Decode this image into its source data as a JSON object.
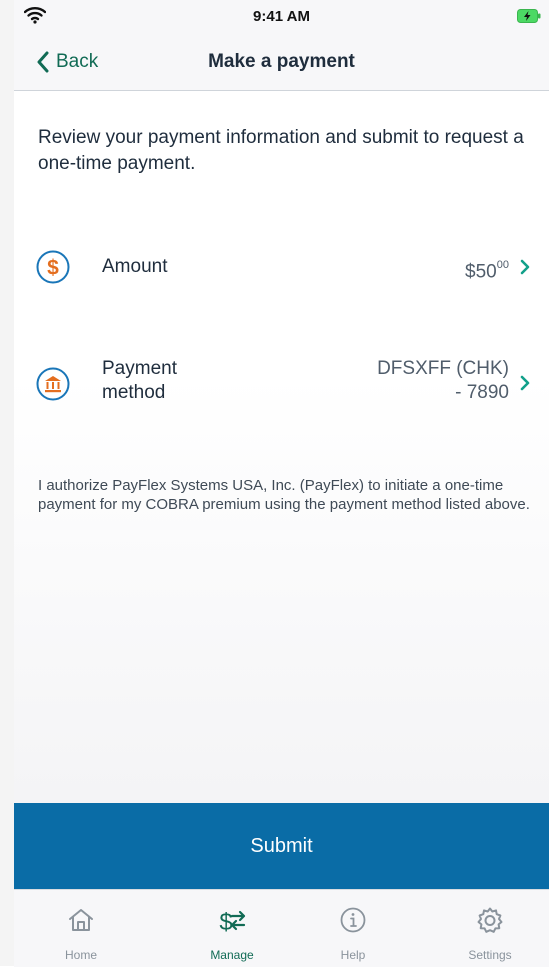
{
  "status_bar": {
    "time": "9:41 AM"
  },
  "nav": {
    "back_label": "Back",
    "title": "Make a payment"
  },
  "intro_text": "Review your payment information and submit to request a one-time payment.",
  "amount": {
    "label": "Amount",
    "value_main": "$50",
    "value_cents": "00"
  },
  "payment_method": {
    "label_line1": "Payment",
    "label_line2": "method",
    "value_line1": "DFSXFF (CHK)",
    "value_line2": "- 7890"
  },
  "disclaimer": "I authorize PayFlex Systems USA, Inc. (PayFlex) to initiate a one-time payment for my COBRA premium using the payment method listed above.",
  "submit_label": "Submit",
  "tabs": [
    {
      "label": "Home",
      "icon": "home-icon",
      "active": false
    },
    {
      "label": "Manage",
      "icon": "manage-dollar-icon",
      "active": true
    },
    {
      "label": "Help",
      "icon": "info-icon",
      "active": false
    },
    {
      "label": "Settings",
      "icon": "gear-icon",
      "active": false
    }
  ],
  "colors": {
    "accent_green": "#116b55",
    "submit_blue": "#0a6ca6",
    "amount_icon_orange": "#e46e1f",
    "method_icon_blue": "#1a76b8",
    "chevron_teal": "#12a08a"
  }
}
